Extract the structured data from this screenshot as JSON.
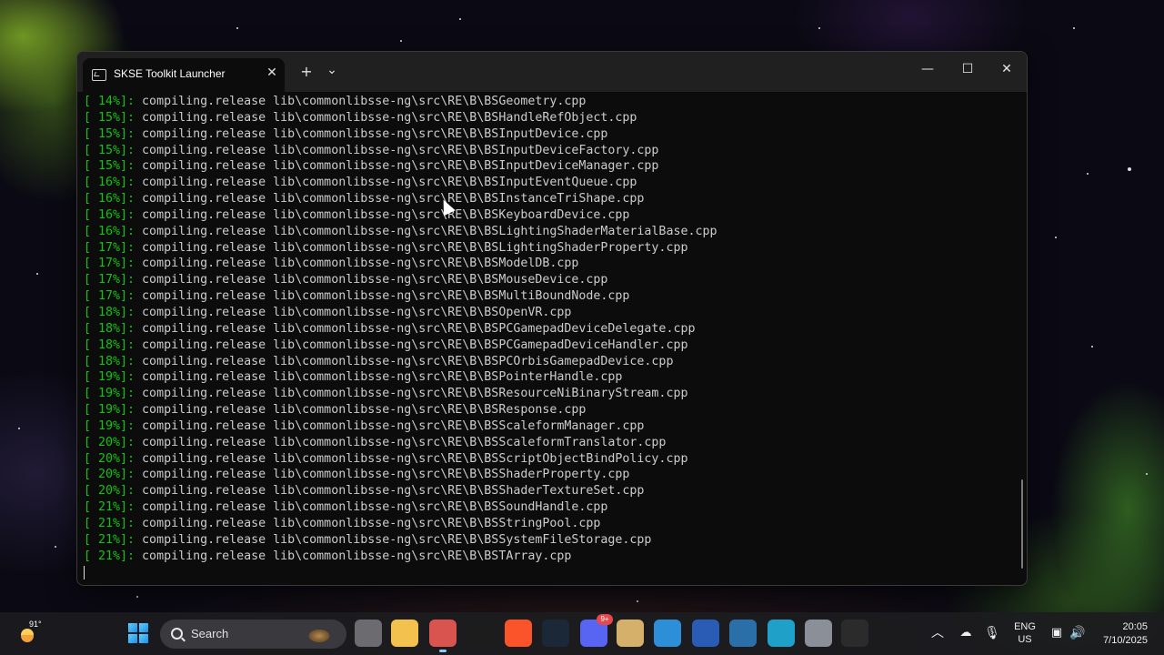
{
  "window": {
    "tab_title": "SKSE Toolkit Launcher",
    "tab_close": "✕",
    "new_tab": "+",
    "dropdown": "⌄",
    "minimize": "—",
    "maximize": "☐",
    "close": "✕"
  },
  "terminal": {
    "lines": [
      {
        "pct": "[ 14%]:",
        "text": " compiling.release lib\\commonlibsse-ng\\src\\RE\\B\\BSGeometry.cpp"
      },
      {
        "pct": "[ 15%]:",
        "text": " compiling.release lib\\commonlibsse-ng\\src\\RE\\B\\BSHandleRefObject.cpp"
      },
      {
        "pct": "[ 15%]:",
        "text": " compiling.release lib\\commonlibsse-ng\\src\\RE\\B\\BSInputDevice.cpp"
      },
      {
        "pct": "[ 15%]:",
        "text": " compiling.release lib\\commonlibsse-ng\\src\\RE\\B\\BSInputDeviceFactory.cpp"
      },
      {
        "pct": "[ 15%]:",
        "text": " compiling.release lib\\commonlibsse-ng\\src\\RE\\B\\BSInputDeviceManager.cpp"
      },
      {
        "pct": "[ 16%]:",
        "text": " compiling.release lib\\commonlibsse-ng\\src\\RE\\B\\BSInputEventQueue.cpp"
      },
      {
        "pct": "[ 16%]:",
        "text": " compiling.release lib\\commonlibsse-ng\\src\\RE\\B\\BSInstanceTriShape.cpp"
      },
      {
        "pct": "[ 16%]:",
        "text": " compiling.release lib\\commonlibsse-ng\\src\\RE\\B\\BSKeyboardDevice.cpp"
      },
      {
        "pct": "[ 16%]:",
        "text": " compiling.release lib\\commonlibsse-ng\\src\\RE\\B\\BSLightingShaderMaterialBase.cpp"
      },
      {
        "pct": "[ 17%]:",
        "text": " compiling.release lib\\commonlibsse-ng\\src\\RE\\B\\BSLightingShaderProperty.cpp"
      },
      {
        "pct": "[ 17%]:",
        "text": " compiling.release lib\\commonlibsse-ng\\src\\RE\\B\\BSModelDB.cpp"
      },
      {
        "pct": "[ 17%]:",
        "text": " compiling.release lib\\commonlibsse-ng\\src\\RE\\B\\BSMouseDevice.cpp"
      },
      {
        "pct": "[ 17%]:",
        "text": " compiling.release lib\\commonlibsse-ng\\src\\RE\\B\\BSMultiBoundNode.cpp"
      },
      {
        "pct": "[ 18%]:",
        "text": " compiling.release lib\\commonlibsse-ng\\src\\RE\\B\\BSOpenVR.cpp"
      },
      {
        "pct": "[ 18%]:",
        "text": " compiling.release lib\\commonlibsse-ng\\src\\RE\\B\\BSPCGamepadDeviceDelegate.cpp"
      },
      {
        "pct": "[ 18%]:",
        "text": " compiling.release lib\\commonlibsse-ng\\src\\RE\\B\\BSPCGamepadDeviceHandler.cpp"
      },
      {
        "pct": "[ 18%]:",
        "text": " compiling.release lib\\commonlibsse-ng\\src\\RE\\B\\BSPCOrbisGamepadDevice.cpp"
      },
      {
        "pct": "[ 19%]:",
        "text": " compiling.release lib\\commonlibsse-ng\\src\\RE\\B\\BSPointerHandle.cpp"
      },
      {
        "pct": "[ 19%]:",
        "text": " compiling.release lib\\commonlibsse-ng\\src\\RE\\B\\BSResourceNiBinaryStream.cpp"
      },
      {
        "pct": "[ 19%]:",
        "text": " compiling.release lib\\commonlibsse-ng\\src\\RE\\B\\BSResponse.cpp"
      },
      {
        "pct": "[ 19%]:",
        "text": " compiling.release lib\\commonlibsse-ng\\src\\RE\\B\\BSScaleformManager.cpp"
      },
      {
        "pct": "[ 20%]:",
        "text": " compiling.release lib\\commonlibsse-ng\\src\\RE\\B\\BSScaleformTranslator.cpp"
      },
      {
        "pct": "[ 20%]:",
        "text": " compiling.release lib\\commonlibsse-ng\\src\\RE\\B\\BSScriptObjectBindPolicy.cpp"
      },
      {
        "pct": "[ 20%]:",
        "text": " compiling.release lib\\commonlibsse-ng\\src\\RE\\B\\BSShaderProperty.cpp"
      },
      {
        "pct": "[ 20%]:",
        "text": " compiling.release lib\\commonlibsse-ng\\src\\RE\\B\\BSShaderTextureSet.cpp"
      },
      {
        "pct": "[ 21%]:",
        "text": " compiling.release lib\\commonlibsse-ng\\src\\RE\\B\\BSSoundHandle.cpp"
      },
      {
        "pct": "[ 21%]:",
        "text": " compiling.release lib\\commonlibsse-ng\\src\\RE\\B\\BSStringPool.cpp"
      },
      {
        "pct": "[ 21%]:",
        "text": " compiling.release lib\\commonlibsse-ng\\src\\RE\\B\\BSSystemFileStorage.cpp"
      },
      {
        "pct": "[ 21%]:",
        "text": " compiling.release lib\\commonlibsse-ng\\src\\RE\\B\\BSTArray.cpp"
      }
    ]
  },
  "taskbar": {
    "weather_temp": "91°",
    "search_placeholder": "Search",
    "apps": [
      {
        "name": "task-view-icon",
        "color": "#6b6b70"
      },
      {
        "name": "file-explorer-icon",
        "color": "#f2c14e"
      },
      {
        "name": "paint-icon",
        "color": "#d9534f"
      },
      {
        "name": "capcut-icon",
        "color": "#1c1c1c"
      },
      {
        "name": "brave-icon",
        "color": "#fb542b"
      },
      {
        "name": "steam-icon",
        "color": "#1b2838"
      },
      {
        "name": "discord-icon",
        "color": "#5865f2"
      },
      {
        "name": "sandwich-app-icon",
        "color": "#d4b06a"
      },
      {
        "name": "controller-app-icon",
        "color": "#2d8fd8"
      },
      {
        "name": "powershell-icon",
        "color": "#2a5bb5"
      },
      {
        "name": "steam-alt-icon",
        "color": "#2a6fa8"
      },
      {
        "name": "edge-icon",
        "color": "#1fa0c8"
      },
      {
        "name": "settings-icon",
        "color": "#8a8f98"
      },
      {
        "name": "terminal-icon",
        "color": "#2b2b2b"
      }
    ],
    "discord_badge": "9+",
    "lang_line1": "ENG",
    "lang_line2": "US",
    "time": "20:05",
    "date": "7/10/2025"
  },
  "colors": {
    "percent_green": "#13c313",
    "terminal_bg": "#0c0c0c",
    "terminal_text": "#cccccc"
  }
}
